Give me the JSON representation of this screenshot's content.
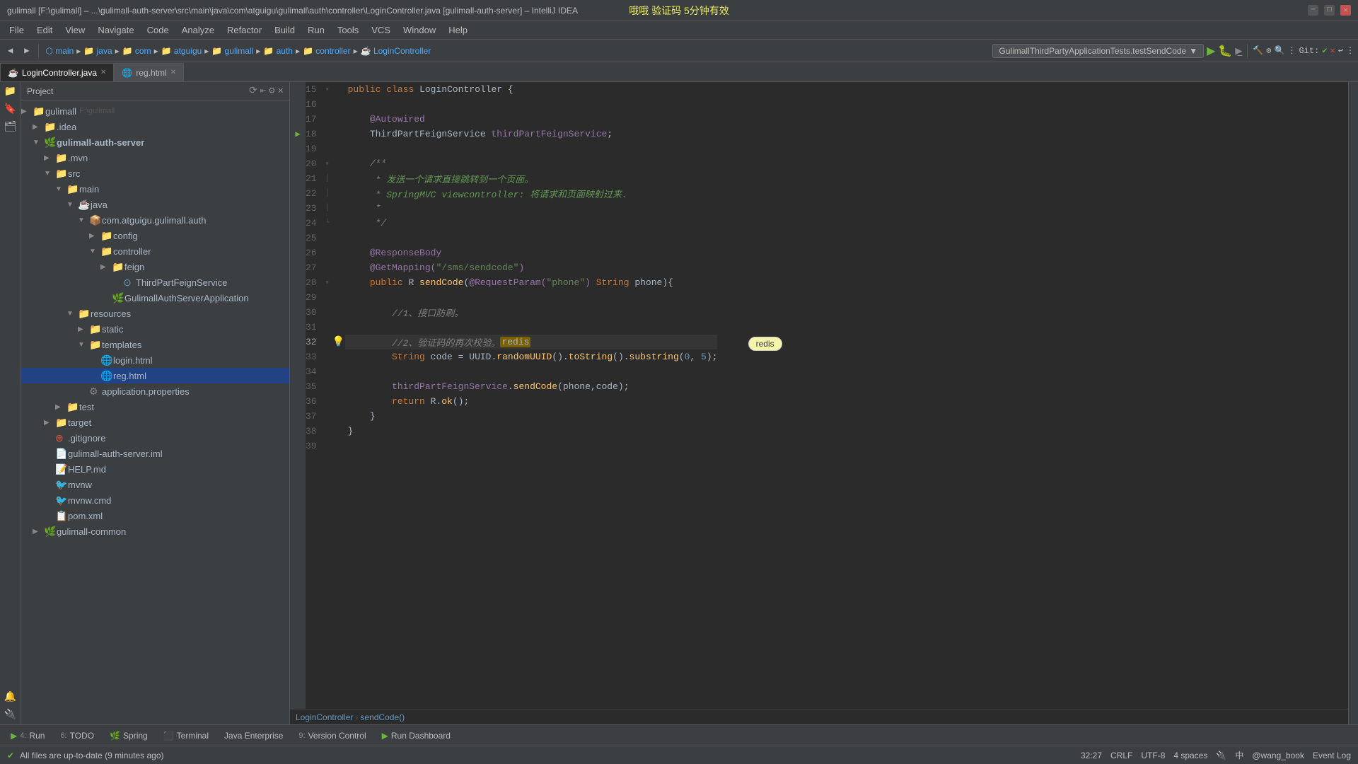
{
  "window": {
    "title": "gulimall [F:\\gulimall] – ...\\gulimall-auth-server\\src\\main\\java\\com\\atguigu\\gulimall\\auth\\controller\\LoginController.java [gulimall-auth-server] – IntelliJ IDEA",
    "minimize": "─",
    "maximize": "□",
    "close": "✕"
  },
  "menu": {
    "items": [
      "File",
      "Edit",
      "View",
      "Navigate",
      "Code",
      "Analyze",
      "Refactor",
      "Build",
      "Run",
      "Tools",
      "VCS",
      "Window",
      "Help"
    ]
  },
  "toolbar": {
    "breadcrumb_items": [
      "main",
      "java",
      "com",
      "atguigu",
      "gulimall",
      "auth",
      "controller",
      "LoginController"
    ],
    "run_config": "GulimallThirdPartyApplicationTests.testSendCode",
    "git_label": "Git:"
  },
  "tabs": [
    {
      "name": "LoginController.java",
      "active": true,
      "icon": "java"
    },
    {
      "name": "reg.html",
      "active": false,
      "icon": "html"
    }
  ],
  "project_tree": {
    "root_label": "Project",
    "items": [
      {
        "indent": 0,
        "arrow": "▶",
        "icon": "folder",
        "label": "gulimall",
        "sub": "F:\\gulimall"
      },
      {
        "indent": 1,
        "arrow": "▼",
        "icon": "folder",
        "label": ".idea"
      },
      {
        "indent": 1,
        "arrow": "▼",
        "icon": "folder-spring",
        "label": "gulimall-auth-server",
        "expanded": true
      },
      {
        "indent": 2,
        "arrow": "▶",
        "icon": "folder",
        "label": ".mvn"
      },
      {
        "indent": 2,
        "arrow": "▼",
        "icon": "folder",
        "label": "src",
        "expanded": true
      },
      {
        "indent": 3,
        "arrow": "▼",
        "icon": "folder",
        "label": "main",
        "expanded": true
      },
      {
        "indent": 4,
        "arrow": "▼",
        "icon": "folder",
        "label": "java",
        "expanded": true
      },
      {
        "indent": 5,
        "arrow": "▼",
        "icon": "folder",
        "label": "com.atguigu.gulimall.auth",
        "expanded": true
      },
      {
        "indent": 6,
        "arrow": "▶",
        "icon": "folder",
        "label": "config"
      },
      {
        "indent": 6,
        "arrow": "▼",
        "icon": "folder",
        "label": "controller",
        "expanded": true
      },
      {
        "indent": 7,
        "arrow": "▶",
        "icon": "folder",
        "label": "feign"
      },
      {
        "indent": 8,
        "arrow": "",
        "icon": "java-interface",
        "label": "ThirdPartFeignService"
      },
      {
        "indent": 7,
        "arrow": "",
        "icon": "java-spring",
        "label": "GulimallAuthServerApplication"
      },
      {
        "indent": 6,
        "arrow": "▼",
        "icon": "folder",
        "label": "resources",
        "expanded": true
      },
      {
        "indent": 7,
        "arrow": "▶",
        "icon": "folder",
        "label": "static"
      },
      {
        "indent": 7,
        "arrow": "▼",
        "icon": "folder",
        "label": "templates",
        "expanded": true
      },
      {
        "indent": 8,
        "arrow": "",
        "icon": "html",
        "label": "login.html"
      },
      {
        "indent": 8,
        "arrow": "",
        "icon": "html-selected",
        "label": "reg.html",
        "selected": true
      },
      {
        "indent": 7,
        "arrow": "",
        "icon": "prop",
        "label": "application.properties"
      },
      {
        "indent": 3,
        "arrow": "▶",
        "icon": "folder",
        "label": "test"
      },
      {
        "indent": 2,
        "arrow": "▶",
        "icon": "folder",
        "label": "target"
      },
      {
        "indent": 2,
        "arrow": "",
        "icon": "git",
        "label": ".gitignore"
      },
      {
        "indent": 2,
        "arrow": "",
        "icon": "iml",
        "label": "gulimall-auth-server.iml"
      },
      {
        "indent": 2,
        "arrow": "",
        "icon": "md",
        "label": "HELP.md"
      },
      {
        "indent": 2,
        "arrow": "",
        "icon": "mvn",
        "label": "mvnw"
      },
      {
        "indent": 2,
        "arrow": "",
        "icon": "mvn",
        "label": "mvnw.cmd"
      },
      {
        "indent": 2,
        "arrow": "",
        "icon": "xml",
        "label": "pom.xml"
      },
      {
        "indent": 1,
        "arrow": "▶",
        "icon": "folder",
        "label": "gulimall-common"
      }
    ]
  },
  "code": {
    "lines": [
      {
        "num": 15,
        "content": "public class LoginController {",
        "tokens": [
          {
            "t": "kw",
            "v": "public"
          },
          {
            "t": "sp",
            "v": " "
          },
          {
            "t": "kw",
            "v": "class"
          },
          {
            "t": "sp",
            "v": " "
          },
          {
            "t": "type",
            "v": "LoginController"
          },
          {
            "t": "sp",
            "v": " {"
          }
        ]
      },
      {
        "num": 16,
        "content": ""
      },
      {
        "num": 17,
        "content": "    @Autowired",
        "tokens": [
          {
            "t": "ann",
            "v": "    @Autowired"
          }
        ]
      },
      {
        "num": 18,
        "content": "    ThirdPartFeignService thirdPartFeignService;",
        "tokens": [
          {
            "t": "sp",
            "v": "    "
          },
          {
            "t": "type",
            "v": "ThirdPartFeignService"
          },
          {
            "t": "sp",
            "v": " "
          },
          {
            "t": "field",
            "v": "thirdPartFeignService"
          },
          {
            "t": "sp",
            "v": ";"
          }
        ]
      },
      {
        "num": 19,
        "content": ""
      },
      {
        "num": 20,
        "content": "    /**",
        "tokens": [
          {
            "t": "comment",
            "v": "    /**"
          }
        ]
      },
      {
        "num": 21,
        "content": "     * 发送一个请求直接跳转到一个页面。",
        "tokens": [
          {
            "t": "comment-kw",
            "v": "     * 发送一个请求直接跳转到一个页面。"
          }
        ]
      },
      {
        "num": 22,
        "content": "     * SpringMVC viewcontroller: 将请求和页面映射过来.",
        "tokens": [
          {
            "t": "comment-kw",
            "v": "     * SpringMVC viewcontroller: 将请求和页面映射过来."
          }
        ]
      },
      {
        "num": 23,
        "content": "     *",
        "tokens": [
          {
            "t": "comment",
            "v": "     *"
          }
        ]
      },
      {
        "num": 24,
        "content": "     */",
        "tokens": [
          {
            "t": "comment",
            "v": "     */"
          }
        ]
      },
      {
        "num": 25,
        "content": ""
      },
      {
        "num": 26,
        "content": "    @ResponseBody",
        "tokens": [
          {
            "t": "ann",
            "v": "    @ResponseBody"
          }
        ]
      },
      {
        "num": 27,
        "content": "    @GetMapping(\"/sms/sendcode\")",
        "tokens": [
          {
            "t": "ann",
            "v": "    @GetMapping("
          },
          {
            "t": "str",
            "v": "\"/sms/sendcode\""
          },
          {
            "t": "ann",
            "v": ")"
          }
        ]
      },
      {
        "num": 28,
        "content": "    public R sendCode(@RequestParam(\"phone\") String phone){",
        "tokens": [
          {
            "t": "sp",
            "v": "    "
          },
          {
            "t": "kw",
            "v": "public"
          },
          {
            "t": "sp",
            "v": " R "
          },
          {
            "t": "method",
            "v": "sendCode"
          },
          {
            "t": "sp",
            "v": "("
          },
          {
            "t": "ann",
            "v": "@RequestParam("
          },
          {
            "t": "str",
            "v": "\"phone\""
          },
          {
            "t": "ann",
            "v": ")"
          },
          {
            "t": "sp",
            "v": " "
          },
          {
            "t": "kw",
            "v": "String"
          },
          {
            "t": "sp",
            "v": " phone){"
          }
        ]
      },
      {
        "num": 29,
        "content": ""
      },
      {
        "num": 30,
        "content": "        //1、接口防刷。",
        "tokens": [
          {
            "t": "comment",
            "v": "        //1、接口防刷。"
          }
        ]
      },
      {
        "num": 31,
        "content": ""
      },
      {
        "num": 32,
        "content": "        //2、验证码的再次校验。redis",
        "tokens": [
          {
            "t": "comment",
            "v": "        //2、验证码的再次校验。"
          },
          {
            "t": "highlight",
            "v": "redis"
          }
        ],
        "current": true
      },
      {
        "num": 33,
        "content": "        String code = UUID.randomUUID().toString().substring(0, 5);",
        "tokens": [
          {
            "t": "sp",
            "v": "        "
          },
          {
            "t": "kw",
            "v": "String"
          },
          {
            "t": "sp",
            "v": " code = "
          },
          {
            "t": "type",
            "v": "UUID"
          },
          {
            "t": "sp",
            "v": "."
          },
          {
            "t": "method",
            "v": "randomUUID"
          },
          {
            "t": "sp",
            "v": "()."
          },
          {
            "t": "method",
            "v": "toString"
          },
          {
            "t": "sp",
            "v": "()."
          },
          {
            "t": "method",
            "v": "substring"
          },
          {
            "t": "sp",
            "v": "("
          },
          {
            "t": "num",
            "v": "0"
          },
          {
            "t": "sp",
            "v": ", "
          },
          {
            "t": "num",
            "v": "5"
          },
          {
            "t": "sp",
            "v": ");"
          }
        ]
      },
      {
        "num": 34,
        "content": ""
      },
      {
        "num": 35,
        "content": "        thirdPartFeignService.sendCode(phone,code);",
        "tokens": [
          {
            "t": "sp",
            "v": "        "
          },
          {
            "t": "field",
            "v": "thirdPartFeignService"
          },
          {
            "t": "sp",
            "v": "."
          },
          {
            "t": "method",
            "v": "sendCode"
          },
          {
            "t": "sp",
            "v": "(phone,code);"
          }
        ]
      },
      {
        "num": 36,
        "content": "        return R.ok();",
        "tokens": [
          {
            "t": "sp",
            "v": "        "
          },
          {
            "t": "kw",
            "v": "return"
          },
          {
            "t": "sp",
            "v": " R."
          },
          {
            "t": "method",
            "v": "ok"
          },
          {
            "t": "sp",
            "v": "();"
          }
        ]
      },
      {
        "num": 37,
        "content": "    }",
        "tokens": [
          {
            "t": "sp",
            "v": "    }"
          }
        ]
      },
      {
        "num": 38,
        "content": "}"
      },
      {
        "num": 39,
        "content": ""
      }
    ]
  },
  "editor_breadcrumb": {
    "items": [
      "LoginController",
      "sendCode()"
    ]
  },
  "status_bar": {
    "message": "All files are up-to-date (9 minutes ago)",
    "position": "32:27",
    "line_ending": "CRLF",
    "encoding": "UTF-8",
    "indent": "4 spaces",
    "event_log": "Event Log"
  },
  "bottom_tabs": [
    {
      "num": "4:",
      "label": "Run"
    },
    {
      "num": "6:",
      "label": "TODO"
    },
    {
      "num": "",
      "label": "Spring"
    },
    {
      "num": "",
      "label": "Terminal"
    },
    {
      "num": "",
      "label": "Java Enterprise"
    },
    {
      "num": "9:",
      "label": "Version Control"
    },
    {
      "num": "",
      "label": "Run Dashboard"
    }
  ],
  "watermark": {
    "text": "哦哦  验证码    5分钟有效"
  }
}
